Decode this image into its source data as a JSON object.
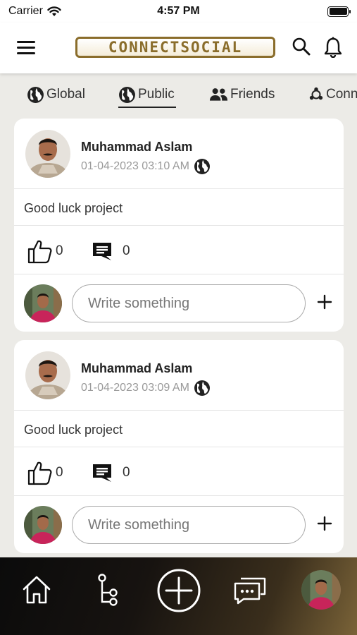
{
  "status_bar": {
    "carrier": "Carrier",
    "time": "4:57 PM"
  },
  "header": {
    "logo_text": "CONNECTSOCIAL",
    "logo_color": "#8a6d2b"
  },
  "tabs": [
    {
      "label": "Global",
      "icon": "globe-icon"
    },
    {
      "label": "Public",
      "icon": "globe-icon",
      "selected": true
    },
    {
      "label": "Friends",
      "icon": "friends-icon"
    },
    {
      "label": "Conn",
      "icon": "connections-icon"
    }
  ],
  "posts": [
    {
      "author": "Muhammad Aslam",
      "timestamp": "01-04-2023 03:10 AM",
      "privacy_icon": "globe-icon",
      "text": "Good luck project",
      "likes": "0",
      "comments": "0",
      "reply_placeholder": "Write something"
    },
    {
      "author": "Muhammad Aslam",
      "timestamp": "01-04-2023 03:09 AM",
      "privacy_icon": "globe-icon",
      "text": "Good luck project",
      "likes": "0",
      "comments": "0",
      "reply_placeholder": "Write something"
    }
  ],
  "bottom_nav": [
    {
      "icon": "home-icon"
    },
    {
      "icon": "network-icon"
    },
    {
      "icon": "add-post-icon"
    },
    {
      "icon": "chat-icon"
    },
    {
      "icon": "profile-avatar"
    }
  ]
}
